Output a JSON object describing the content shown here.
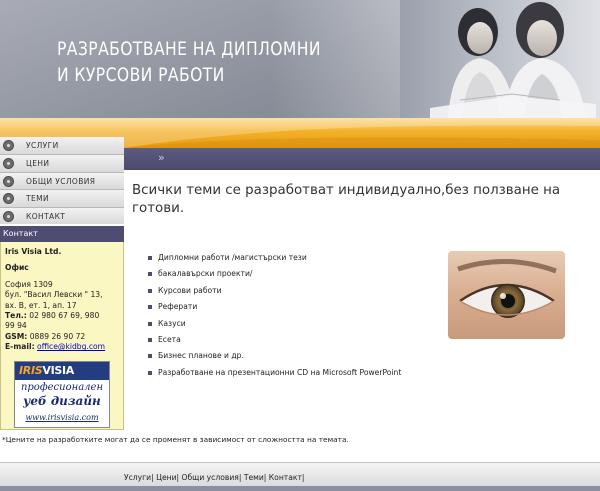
{
  "header": {
    "title_line1": "РАЗРАБОТВАНЕ НА ДИПЛОМНИ",
    "title_line2": "И КУРСОВИ РАБОТИ"
  },
  "menu": {
    "items": [
      {
        "label": "УСЛУГИ"
      },
      {
        "label": "ЦЕНИ"
      },
      {
        "label": "ОБЩИ УСЛОВИЯ"
      },
      {
        "label": "ТЕМИ"
      },
      {
        "label": "КОНТАКТ"
      }
    ]
  },
  "purple_bar": {
    "arrows": "»"
  },
  "contact": {
    "header": "Контакт",
    "company": "Iris Visia Ltd.",
    "office_label": "Офис",
    "address_line1": "София 1309",
    "address_line2": "бул. \"Васил Левски \" 13,",
    "address_line3": "вх. В, ет. 1, ап. 17",
    "phone_label": "Тел.:",
    "phone_value": " 02 980 67 69, 980",
    "phone_value2": "99 94",
    "gsm_label": "GSM:",
    "gsm_value": " 0889 26 90 72",
    "email_label": "E-mail:",
    "email_value": "office@kidbg.com"
  },
  "banner": {
    "logo_part1": "IRIS",
    "logo_part2": "VISIA",
    "tagline1": "професионален",
    "tagline2": "уеб дизайн",
    "url": "www.irisvisia.com"
  },
  "main": {
    "heading": "Всички теми се разработват индивидуално,без ползване на готови.",
    "topics": [
      "Дипломни работи /магистърски тези",
      "бакалавърски проекти/",
      "Курсови работи",
      "Реферати",
      "Казуси",
      "Есета",
      "Бизнес планове и др.",
      "Разработване на презентационни CD на Microsoft PowerPoint"
    ],
    "footnote": "*Цените на разработките могат да се променят в зависимост от сложността на темата."
  },
  "footer": {
    "links": [
      "Услуги",
      "Цени",
      "Общи условия",
      "Теми",
      "Контакт"
    ],
    "separator": "|"
  },
  "colors": {
    "purple": "#4f4c72",
    "orange": "#f3b12a",
    "contact_bg": "#fbf7c3",
    "link": "#0000cc"
  }
}
